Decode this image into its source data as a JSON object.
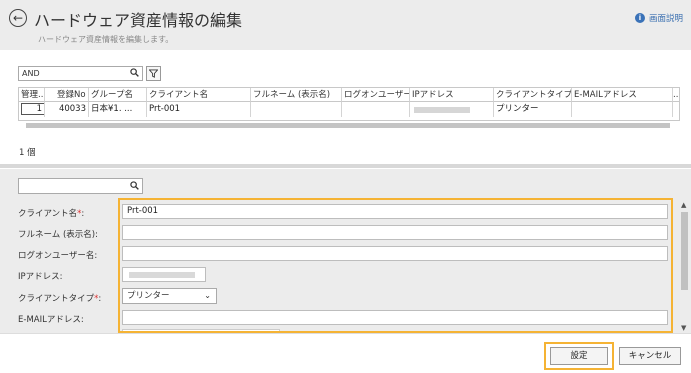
{
  "header": {
    "title": "ハードウェア資産情報の編集",
    "subtitle": "ハードウェア資産情報を編集します。",
    "help_label": "画面説明",
    "help_icon_glyph": "i",
    "back_icon_glyph": "←"
  },
  "list_search": {
    "value": "AND",
    "placeholder": ""
  },
  "table": {
    "columns": [
      "管理...",
      "登録No",
      "グループ名",
      "クライアント名",
      "フルネーム (表示名)",
      "ログオンユーザー...",
      "IPアドレス",
      "クライアントタイプ",
      "E-MAILアドレス",
      "..."
    ],
    "rows": [
      {
        "manage": "1",
        "reg_no": "40033",
        "group": "日本¥1. ...",
        "client": "Prt-001",
        "fullname": "",
        "logon_user": "",
        "ip": "",
        "client_type": "プリンター",
        "email": ""
      }
    ]
  },
  "result_count": "1 個",
  "detail_search": {
    "value": "",
    "placeholder": ""
  },
  "form": {
    "client_name": {
      "label": "クライアント名",
      "required_mark": "*",
      "suffix": ":",
      "value": "Prt-001"
    },
    "fullname": {
      "label": "フルネーム (表示名):",
      "value": ""
    },
    "logon_user": {
      "label": "ログオンユーザー名:",
      "value": ""
    },
    "ip_address": {
      "label": "IPアドレス:",
      "value": ""
    },
    "client_type": {
      "label": "クライアントタイプ",
      "required_mark": "*",
      "suffix": ":",
      "value": "プリンター"
    },
    "email": {
      "label": "E-MAILアドレス:",
      "value": ""
    }
  },
  "footer": {
    "set_label": "設定",
    "cancel_label": "キャンセル"
  },
  "colors": {
    "highlight": "#f5b334",
    "help_link": "#3a6fb0",
    "required": "#dd3333"
  }
}
